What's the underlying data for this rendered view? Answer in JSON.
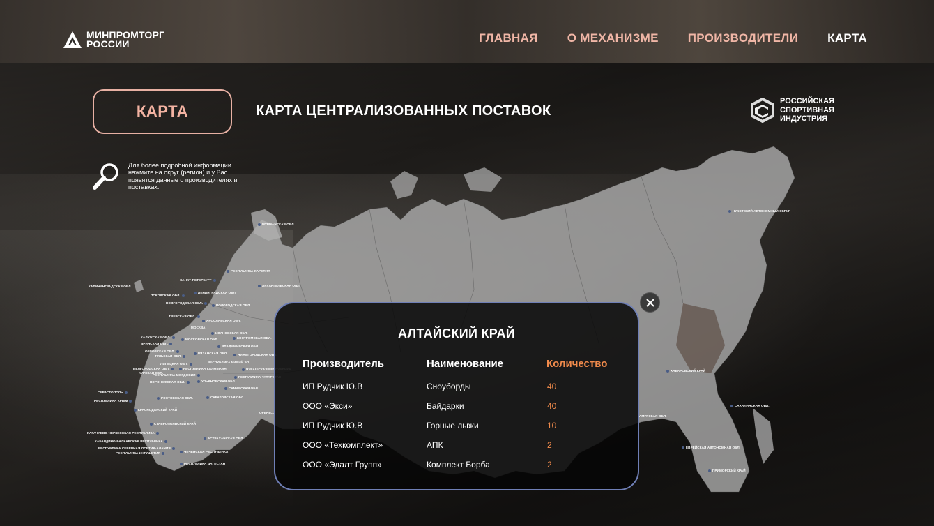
{
  "header": {
    "logo_line1": "МИНПРОМТОРГ",
    "logo_line2": "РОССИИ",
    "nav": [
      {
        "label": "ГЛАВНАЯ",
        "active": false
      },
      {
        "label": "О МЕХАНИЗМЕ",
        "active": false
      },
      {
        "label": "ПРОИЗВОДИТЕЛИ",
        "active": false
      },
      {
        "label": "КАРТА",
        "active": true
      }
    ]
  },
  "page": {
    "badge": "КАРТА",
    "title": "КАРТА ЦЕНТРАЛИЗОВАННЫХ ПОСТАВОК",
    "partner": {
      "line1": "РОССИЙСКАЯ",
      "line2": "СПОРТИВНАЯ",
      "line3": "ИНДУСТРИЯ"
    },
    "hint": "Для более подробной информации нажмите на округ (регион) и у Вас появятся данные о производителях и поставках."
  },
  "map_labels": [
    "МУРМАНСКАЯ ОБЛ.",
    "РЕСПУБЛИКА КАРЕЛИЯ",
    "САНКТ-ПЕТЕРБУРГ",
    "АРХАНГЕЛЬСКАЯ ОБЛ.",
    "КАЛИНИНГРАДСКАЯ ОБЛ.",
    "ПСКОВСКАЯ ОБЛ.",
    "ЛЕНИНГРАДСКАЯ ОБЛ.",
    "НОВГОРОДСКАЯ ОБЛ.",
    "ВОЛОГОДСКАЯ ОБЛ.",
    "ТВЕРСКАЯ ОБЛ.",
    "ЯРОСЛАВСКАЯ ОБЛ.",
    "МОСКВА",
    "ИВАНОВСКАЯ ОБЛ.",
    "КАЛУЖСКАЯ ОБЛ.",
    "МОСКОВСКАЯ ОБЛ.",
    "КОСТРОМСКАЯ ОБЛ.",
    "БРЯНСКАЯ ОБЛ.",
    "ВЛАДИМИРСКАЯ ОБЛ.",
    "ОРЛОВСКАЯ ОБЛ.",
    "ТУЛЬСКАЯ ОБЛ.",
    "РЯЗАНСКАЯ ОБЛ.",
    "НИЖЕГОРОДСКАЯ ОБЛ.",
    "ЛИПЕЦКАЯ ОБЛ.",
    "РЕСПУБЛИКА МАРИЙ ЭЛ",
    "БЕЛГОРОДСКАЯ ОБЛ.",
    "РЕСПУБЛИКА КАЛМЫКИЯ",
    "ЧУВАШСКАЯ РЕСПУБЛИКА",
    "КУРСКАЯ ОБЛ.",
    "РЕСПУБЛИКА МОРДОВИЯ",
    "РЕСПУБЛИКА ТАТАРСТАН",
    "ВОРОНЕЖСКАЯ ОБЛ.",
    "УЛЬЯНОВСКАЯ ОБЛ.",
    "САМАРСКАЯ ОБЛ.",
    "СЕВАСТОПОЛЬ",
    "РОСТОВСКАЯ ОБЛ.",
    "САРАТОВСКАЯ ОБЛ.",
    "РЕСПУБЛИКА КРЫМ",
    "КРАСНОДАРСКИЙ КРАЙ",
    "ОРЕНБ...",
    "СТАВРОПОЛЬСКИЙ КРАЙ",
    "КАРАЧАЕВО-ЧЕРКЕССКАЯ РЕСПУБЛИКА",
    "АСТРАХАНСКАЯ ОБЛ.",
    "КАБАРДИНО-БАЛКАРСКАЯ РЕСПУБЛИКА",
    "РЕСПУБЛИКА СЕВЕРНАЯ ОСЕТИЯ-АЛАНИЯ",
    "ЧЕЧЕНСКАЯ РЕСПУБЛИКА",
    "РЕСПУБЛИКА ИНГУШЕТИЯ",
    "РЕСПУБЛИКА ДАГЕСТАН",
    "ЧУКОТСКИЙ АВТОНОМНЫЙ ОКРУГ",
    "ХАБАРОВСКИЙ КРАЙ",
    "САХАЛИНСКАЯ ОБЛ.",
    "АМУРСКАЯ ОБЛ.",
    "ЕВРЕЙСКАЯ АВТОНОМНАЯ ОБЛ.",
    "ПРИМОРСКИЙ КРАЙ"
  ],
  "popup": {
    "title": "АЛТАЙСКИЙ КРАЙ",
    "headers": {
      "producer": "Производитель",
      "name": "Наименование",
      "qty": "Количество"
    },
    "rows": [
      {
        "producer": "ИП Рудчик Ю.В",
        "name": "Сноуборды",
        "qty": "40"
      },
      {
        "producer": "ООО «Экси»",
        "name": "Байдарки",
        "qty": "40"
      },
      {
        "producer": "ИП Рудчик Ю.В",
        "name": "Горные лыжи",
        "qty": "10"
      },
      {
        "producer": "ООО «Техкомплект»",
        "name": "АПК",
        "qty": "2"
      },
      {
        "producer": "ООО «Эдалт Групп»",
        "name": "Комплект Борба",
        "qty": "2"
      }
    ]
  },
  "colors": {
    "accent": "#f0b6a6",
    "quantity": "#f08a4b",
    "popup_border": "#6f7fb6"
  },
  "icons": {
    "close": "close-icon",
    "search": "magnifier-icon",
    "logo": "minpromtorg-logo-icon",
    "partner": "rsi-logo-icon"
  }
}
